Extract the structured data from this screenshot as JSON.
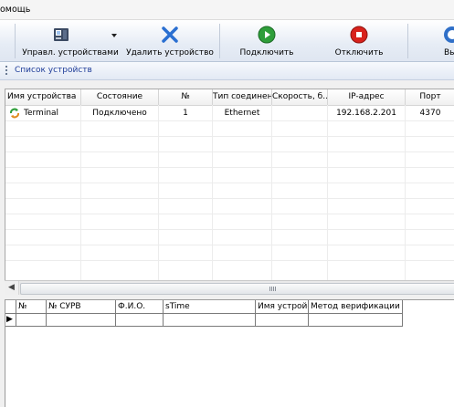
{
  "menubar": {
    "items": [
      {
        "label": "омощь"
      }
    ]
  },
  "toolbar": {
    "buttons": [
      {
        "label": "Управл. устройствами",
        "icon": "device-manager-icon",
        "has_dropdown": true
      },
      {
        "label": "Удалить устройство",
        "icon": "delete-x-icon"
      },
      {
        "label": "Подключить",
        "icon": "play-green-icon"
      },
      {
        "label": "Отключить",
        "icon": "stop-red-icon"
      },
      {
        "label": "Вы",
        "icon": "blue-round-icon"
      }
    ]
  },
  "device_list_panel": {
    "title": "Список устройств",
    "columns": [
      "Имя устройства",
      "Состояние",
      "№",
      "Тип соединен...",
      "Скорость, б...",
      "IP-адрес",
      "Порт"
    ],
    "rows": [
      {
        "icon": "terminal-connected-icon",
        "name": "Terminal",
        "status": "Подключено",
        "number": "1",
        "connection_type": "Ethernet",
        "speed": "",
        "ip": "192.168.2.201",
        "port": "4370"
      }
    ],
    "scrollbar_grip": "|||"
  },
  "events_grid": {
    "columns": [
      "№",
      "№ СУРВ",
      "Ф.И.О.",
      "sTime",
      "Имя устройс",
      "Метод верификации"
    ],
    "current_row_marker": "▶"
  },
  "colors": {
    "panel_title": "#1f3d99",
    "toolbar_gradient_bottom": "#dfe6f1",
    "connect_green": "#2e9e3a",
    "disconnect_red": "#d8221c",
    "delete_blue": "#2a6fd1"
  }
}
